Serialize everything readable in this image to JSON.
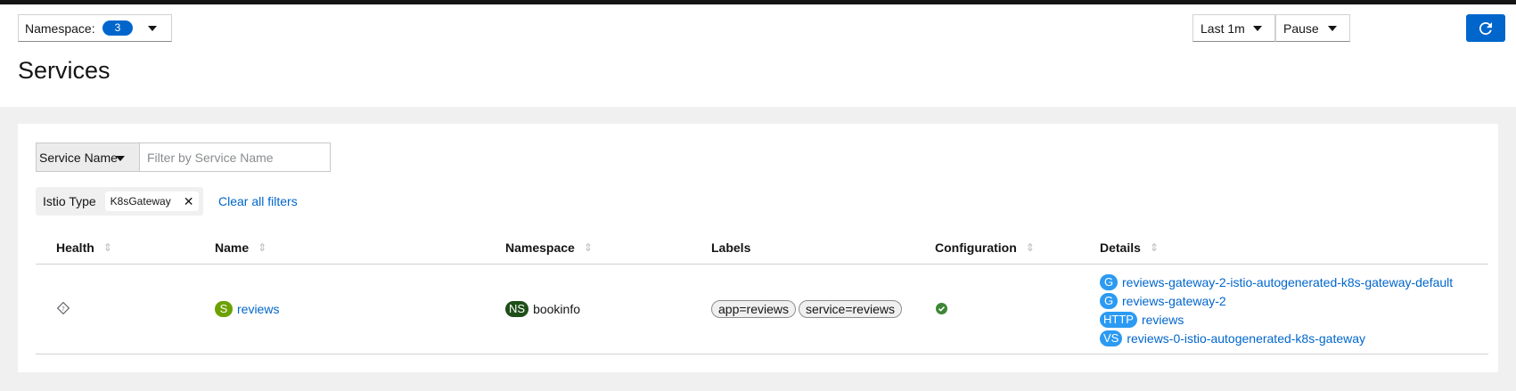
{
  "header": {
    "namespace_label": "Namespace:",
    "namespace_count": "3",
    "page_title": "Services",
    "interval": "Last 1m",
    "refresh_mode": "Pause"
  },
  "filters": {
    "type_label": "Service Name",
    "placeholder": "Filter by Service Name",
    "active_category": "Istio Type",
    "active_value": "K8sGateway",
    "clear_label": "Clear all filters"
  },
  "table": {
    "columns": [
      "Health",
      "Name",
      "Namespace",
      "Labels",
      "Configuration",
      "Details"
    ],
    "rows": [
      {
        "name_badge": "S",
        "name": "reviews",
        "namespace_badge": "NS",
        "namespace": "bookinfo",
        "labels": [
          "app=reviews",
          "service=reviews"
        ],
        "details": [
          {
            "badge": "G",
            "text": "reviews-gateway-2-istio-autogenerated-k8s-gateway-default"
          },
          {
            "badge": "G",
            "text": "reviews-gateway-2"
          },
          {
            "badge": "HTTP",
            "text": "reviews"
          },
          {
            "badge": "VS",
            "text": "reviews-0-istio-autogenerated-k8s-gateway"
          }
        ]
      }
    ]
  },
  "colors": {
    "primary": "#0066cc",
    "service_badge": "#6ca100",
    "namespace_badge": "#1e4f18",
    "detail_badge": "#2b9af3",
    "healthy": "#3e8635"
  },
  "icons": {
    "health": "health-na-icon",
    "config": "check-circle-icon",
    "refresh": "refresh-icon"
  }
}
